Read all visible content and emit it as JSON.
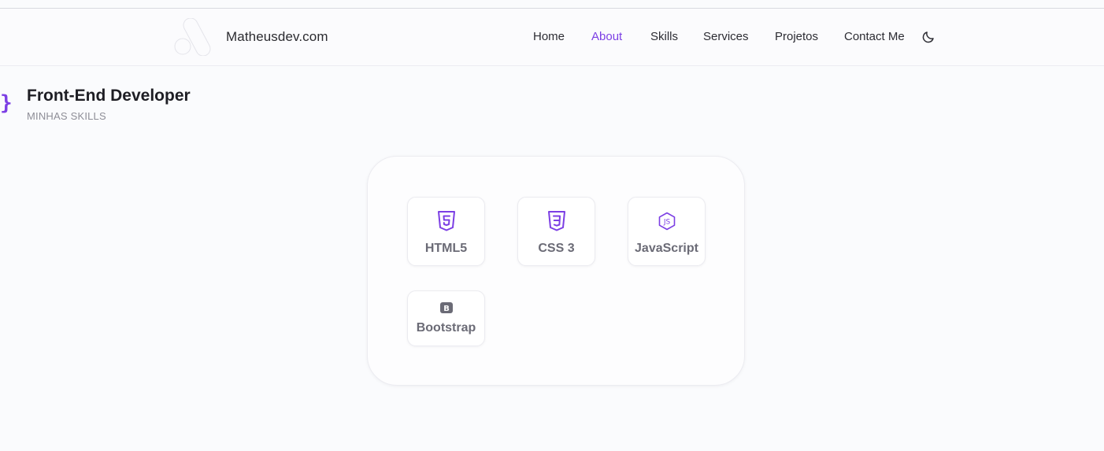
{
  "header": {
    "brand": "Matheusdev.com",
    "nav": [
      {
        "label": "Home",
        "active": false
      },
      {
        "label": "About",
        "active": true
      },
      {
        "label": "Skills",
        "active": false
      },
      {
        "label": "Services",
        "active": false
      },
      {
        "label": "Projetos",
        "active": false
      },
      {
        "label": "Contact Me",
        "active": false
      }
    ],
    "theme_icon": "moon-icon"
  },
  "section": {
    "brace": "}",
    "title": "Front-End Developer",
    "subtitle": "MINHAS SKILLS"
  },
  "skills": [
    {
      "label": "HTML5",
      "icon": "html5-icon"
    },
    {
      "label": "CSS 3",
      "icon": "css3-icon"
    },
    {
      "label": "JavaScript",
      "icon": "javascript-icon"
    },
    {
      "label": "Bootstrap",
      "icon": "bootstrap-icon"
    }
  ],
  "colors": {
    "accent": "#7c3fe4",
    "background": "#fafbfd",
    "text": "#1e1e24",
    "muted": "#8e8e97"
  }
}
